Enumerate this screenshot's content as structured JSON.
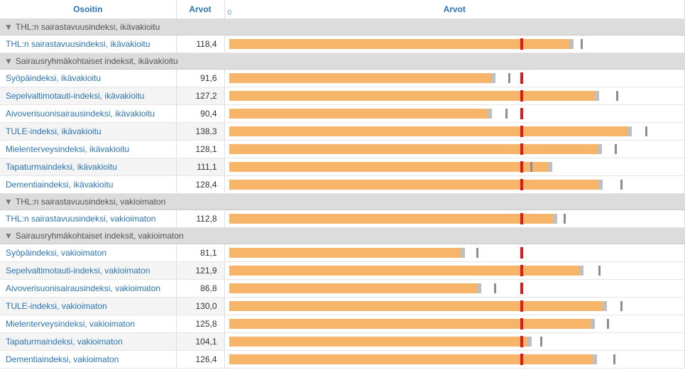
{
  "headers": {
    "indicator": "Osoitin",
    "values": "Arvot",
    "chart": "Arvot",
    "zeroLabel": "0"
  },
  "axis": {
    "max": 155
  },
  "reference": 100.0,
  "groups": [
    {
      "title": "THL:n sairastavuusindeksi, ikävakioitu",
      "rows": [
        {
          "label": "THL:n sairastavuusindeksi, ikävakioitu",
          "valueText": "118,4",
          "value": 118.4,
          "tick": 120.8
        }
      ]
    },
    {
      "title": "Sairausryhmäkohtaiset indeksit, ikävakioitu",
      "rows": [
        {
          "label": "Syöpäindeksi, ikävakioitu",
          "valueText": "91,6",
          "value": 91.6,
          "tick": 96.0
        },
        {
          "label": "Sepelvaltimotauti-indeksi, ikävakioitu",
          "valueText": "127,2",
          "value": 127.2,
          "tick": 133.0
        },
        {
          "label": "Aivoverisuonisairausindeksi, ikävakioitu",
          "valueText": "90,4",
          "value": 90.4,
          "tick": 95.0
        },
        {
          "label": "TULE-indeksi, ikävakioitu",
          "valueText": "138,3",
          "value": 138.3,
          "tick": 143.0
        },
        {
          "label": "Mielenterveysindeksi, ikävakioitu",
          "valueText": "128,1",
          "value": 128.1,
          "tick": 132.5
        },
        {
          "label": "Tapaturmaindeksi, ikävakioitu",
          "valueText": "111,1",
          "value": 111.1,
          "abstick": 103.5
        },
        {
          "label": "Dementiaindeksi, ikävakioitu",
          "valueText": "128,4",
          "value": 128.4,
          "tick": 134.5
        }
      ]
    },
    {
      "title": "THL:n sairastavuusindeksi, vakioimaton",
      "rows": [
        {
          "label": "THL:n sairastavuusindeksi, vakioimaton",
          "valueText": "112,8",
          "value": 112.8,
          "tick": 115.0
        }
      ]
    },
    {
      "title": "Sairausryhmäkohtaiset indeksit, vakioimaton",
      "rows": [
        {
          "label": "Syöpäindeksi, vakioimaton",
          "valueText": "81,1",
          "value": 81.1,
          "tick": 85.0
        },
        {
          "label": "Sepelvaltimotauti-indeksi, vakioimaton",
          "valueText": "121,9",
          "value": 121.9,
          "tick": 127.0
        },
        {
          "label": "Aivoverisuonisairausindeksi, vakioimaton",
          "valueText": "86,8",
          "value": 86.8,
          "tick": 91.0
        },
        {
          "label": "TULE-indeksi, vakioimaton",
          "valueText": "130,0",
          "value": 130.0,
          "tick": 134.5
        },
        {
          "label": "Mielenterveysindeksi, vakioimaton",
          "valueText": "125,8",
          "value": 125.8,
          "tick": 130.0
        },
        {
          "label": "Tapaturmaindeksi, vakioimaton",
          "valueText": "104,1",
          "value": 104.1,
          "tick": 107.0
        },
        {
          "label": "Dementiaindeksi, vakioimaton",
          "valueText": "126,4",
          "value": 126.4,
          "tick": 132.0
        }
      ]
    }
  ],
  "chart_data": {
    "type": "bar",
    "title": "",
    "xlabel": "Arvot",
    "ylabel": "Osoitin",
    "xlim": [
      0,
      155
    ],
    "reference_line": 100.0,
    "series": [
      {
        "name": "Arvot",
        "categories": [
          "THL:n sairastavuusindeksi, ikävakioitu",
          "Syöpäindeksi, ikävakioitu",
          "Sepelvaltimotauti-indeksi, ikävakioitu",
          "Aivoverisuonisairausindeksi, ikävakioitu",
          "TULE-indeksi, ikävakioitu",
          "Mielenterveysindeksi, ikävakioitu",
          "Tapaturmaindeksi, ikävakioitu",
          "Dementiaindeksi, ikävakioitu",
          "THL:n sairastavuusindeksi, vakioimaton",
          "Syöpäindeksi, vakioimaton",
          "Sepelvaltimotauti-indeksi, vakioimaton",
          "Aivoverisuonisairausindeksi, vakioimaton",
          "TULE-indeksi, vakioimaton",
          "Mielenterveysindeksi, vakioimaton",
          "Tapaturmaindeksi, vakioimaton",
          "Dementiaindeksi, vakioimaton"
        ],
        "values": [
          118.4,
          91.6,
          127.2,
          90.4,
          138.3,
          128.1,
          111.1,
          128.4,
          112.8,
          81.1,
          121.9,
          86.8,
          130.0,
          125.8,
          104.1,
          126.4
        ]
      }
    ]
  }
}
